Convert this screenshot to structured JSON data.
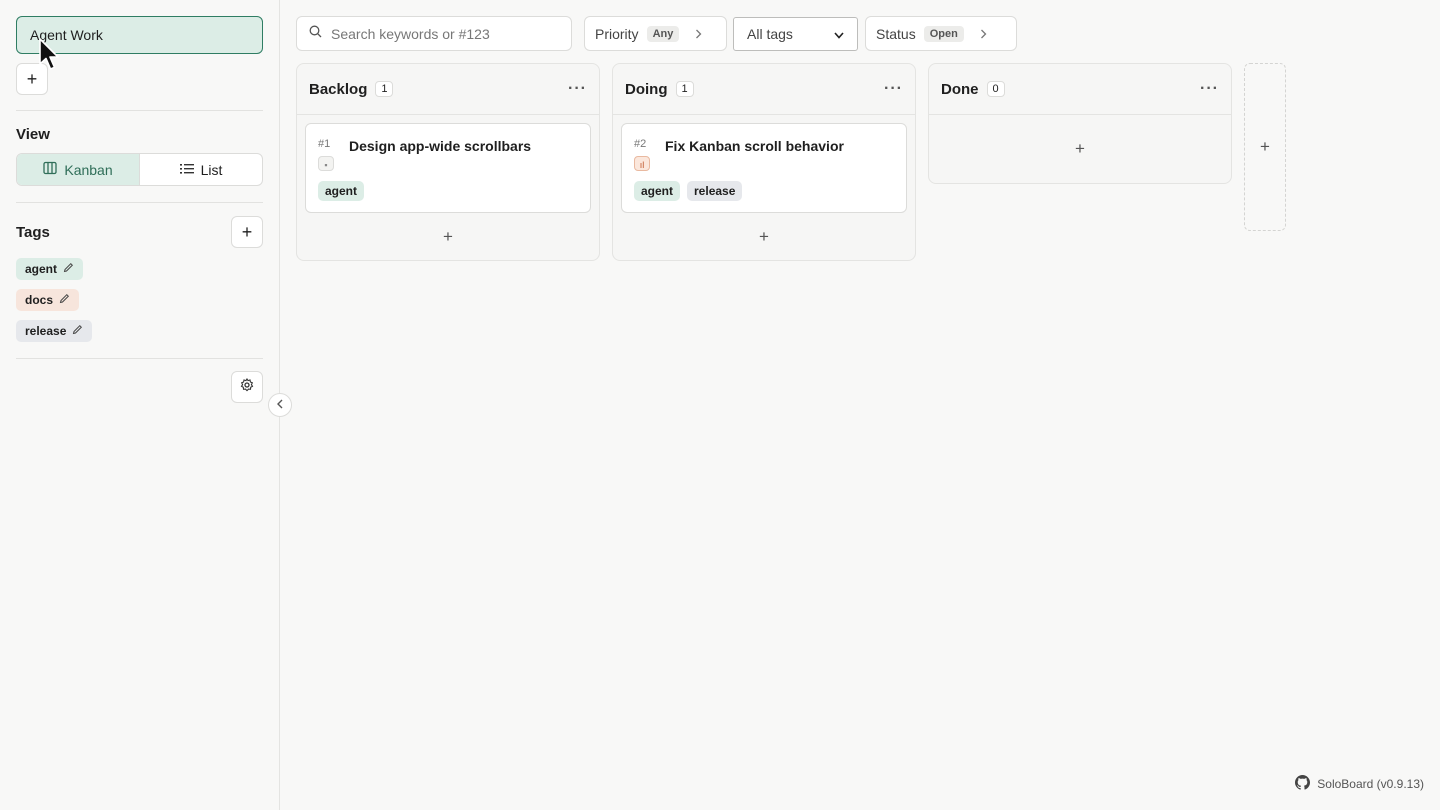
{
  "sidebar": {
    "board_name": "Agent Work",
    "add_board_label": "+",
    "view_title": "View",
    "views": [
      {
        "label": "Kanban",
        "active": true
      },
      {
        "label": "List",
        "active": false
      }
    ],
    "tags_title": "Tags",
    "add_tag_label": "+",
    "tags": [
      {
        "label": "agent",
        "color": "#dcede6"
      },
      {
        "label": "docs",
        "color": "#f7e5dc"
      },
      {
        "label": "release",
        "color": "#e6e8ec"
      }
    ]
  },
  "filters": {
    "search_placeholder": "Search keywords or #123",
    "priority_label": "Priority",
    "priority_value": "Any",
    "tags_select": "All tags",
    "status_label": "Status",
    "status_value": "Open"
  },
  "columns": [
    {
      "title": "Backlog",
      "count": "1",
      "cards": [
        {
          "id": "#1",
          "title": "Design app-wide scrollbars",
          "priority_icon": "low-priority-icon",
          "tags": [
            "agent"
          ]
        }
      ]
    },
    {
      "title": "Doing",
      "count": "1",
      "cards": [
        {
          "id": "#2",
          "title": "Fix Kanban scroll behavior",
          "priority_icon": "medium-priority-icon",
          "tags": [
            "agent",
            "release"
          ]
        }
      ]
    },
    {
      "title": "Done",
      "count": "0",
      "cards": []
    }
  ],
  "add_label": "+",
  "footer": {
    "text": "SoloBoard (v0.9.13)"
  },
  "colors": {
    "accent": "#2f7d63",
    "accent_bg": "#dcede6"
  }
}
